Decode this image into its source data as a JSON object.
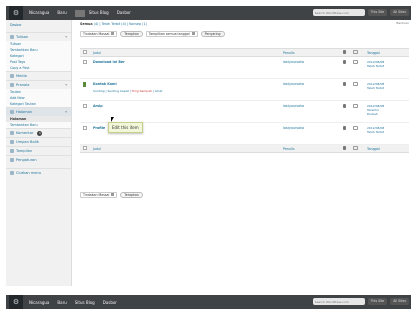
{
  "adminbar": {
    "site": "Nicaragua",
    "new": "Baru",
    "blog": "Situs Blog",
    "dashboard": "Dasbor",
    "search_placeholder": "Search WordPress.com",
    "btn1": "This Site",
    "btn2": "All Sites"
  },
  "sidebar": {
    "dashboard": "Dasbor",
    "posts_head": "Tulisan",
    "posts_items": [
      "Tulisan",
      "Tambahkan Baru",
      "Kategori",
      "Post Tags",
      "Copy a Post"
    ],
    "media": "Media",
    "links_head": "Pranala",
    "links_items": [
      "Tautan",
      "Add New",
      "Kategori Tautan"
    ],
    "pages_head": "Halaman",
    "pages_items": [
      "Halaman",
      "Tambahkan Baru"
    ],
    "comments": "Komentar",
    "comments_badge": "1",
    "feedbacks": "Umpan Balik",
    "appearance": "Tampilan",
    "settings": "Pengaturan",
    "collapse": "Ciutkan menu"
  },
  "main": {
    "subsub_all": "Semua",
    "subsub_rest": "(4) | Telah Terbit (4) | Konsep (1)",
    "help": "Bantuan",
    "bulk_top": "Tindakan Massal",
    "apply_top": "Terapkan",
    "date_filter": "Tampilkan semua tanggal",
    "filter_btn": "Penyaring",
    "bulk_bottom": "Tindakan Massal",
    "apply_bottom": "Terapkan",
    "tooltip": "Edit this item",
    "col_title": "Judul",
    "col_author": "Penulis",
    "col_date": "Tanggal"
  },
  "rows": [
    {
      "title": "Download Ini Ber",
      "author": "lastyoursoka",
      "date1": "2012/08/08",
      "date2": "Telah Terbit",
      "date3": ""
    },
    {
      "title": "Kontak Kami",
      "author": "lastyoursoka",
      "date1": "2012/08/08",
      "date2": "Telah Terbit",
      "date3": ""
    },
    {
      "title": "Arsip",
      "author": "lastyoursoka",
      "date1": "2012/08/08",
      "date2": "Terakhir",
      "date3": "Diubah"
    },
    {
      "title": "Profile",
      "author": "lastyoursoka",
      "date1": "2012/08/08",
      "date2": "Telah Terbit",
      "date3": ""
    }
  ],
  "row_actions": {
    "edit": "Sunting",
    "quick": "Sunting Cepat",
    "trash": "Tong Sampah",
    "view": "Lihat"
  }
}
